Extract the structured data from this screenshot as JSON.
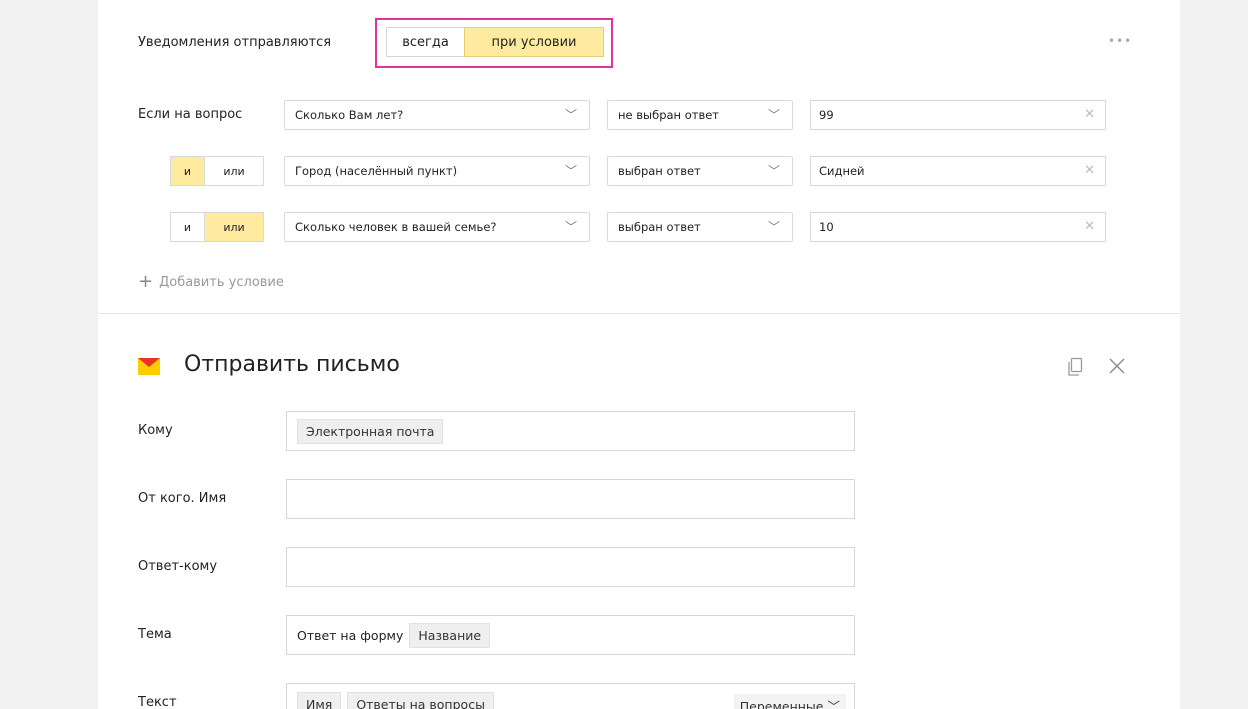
{
  "notify": {
    "label": "Уведомления отправляются",
    "option_always": "всегда",
    "option_condition": "при условии",
    "more": "•••"
  },
  "conditions": {
    "if_label": "Если на вопрос",
    "rows": [
      {
        "question": "Сколько Вам лет?",
        "operator": "не выбран ответ",
        "value": "99"
      },
      {
        "logic_and": "и",
        "logic_or": "или",
        "active": "and",
        "question": "Город (населённый пункт)",
        "operator": "выбран ответ",
        "value": "Сидней"
      },
      {
        "logic_and": "и",
        "logic_or": "или",
        "active": "or",
        "question": "Сколько человек в вашей семье?",
        "operator": "выбран ответ",
        "value": "10"
      }
    ],
    "add_label": "Добавить условие"
  },
  "email": {
    "title": "Отправить письмо",
    "to_label": "Кому",
    "to_chip": "Электронная почта",
    "from_label": "От кого. Имя",
    "from_value": "",
    "reply_label": "Ответ-кому",
    "reply_value": "",
    "subject_label": "Тема",
    "subject_text": "Ответ на форму",
    "subject_chip": "Название",
    "body_label": "Текст",
    "body_chip1": "Имя",
    "body_chip2": "Ответы на вопросы",
    "variables_label": "Переменные"
  },
  "icons": {
    "mail": "mail-icon",
    "copy": "copy-icon",
    "close": "close-icon",
    "chevron": "chevron-down-icon",
    "clear": "clear-icon",
    "plus": "plus-icon"
  },
  "colors": {
    "active_toggle": "#ffeba0",
    "highlight_frame": "#e0339a",
    "mail_yellow": "#ffcc00",
    "mail_red": "#e8322a"
  }
}
